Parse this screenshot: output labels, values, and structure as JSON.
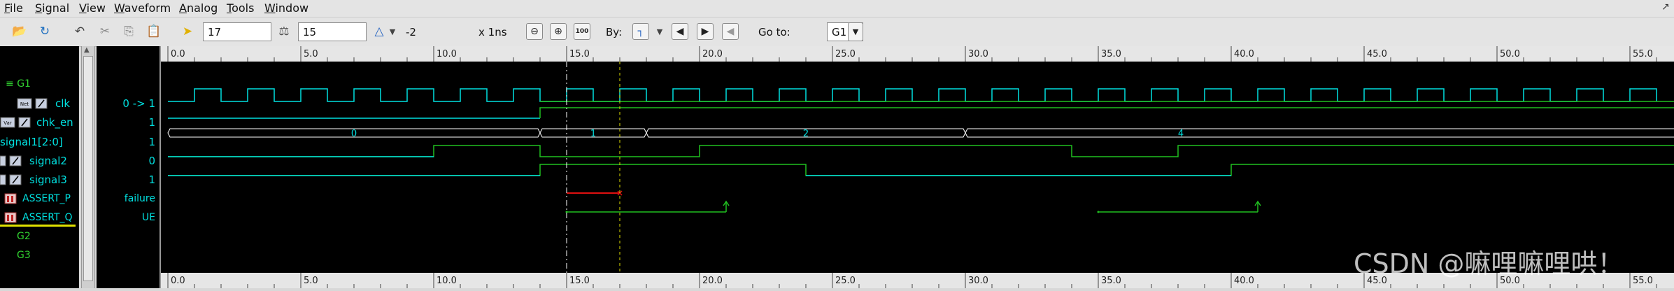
{
  "menu": [
    "File",
    "Signal",
    "View",
    "Waveform",
    "Analog",
    "Tools",
    "Window"
  ],
  "toolbar": {
    "time_value": "17",
    "step_value": "15",
    "delta_value": "-2",
    "time_unit": "x 1ns",
    "by_label": "By:",
    "goto_label": "Go to:",
    "goto_value": "G1",
    "zoom_full_label": "100"
  },
  "ruler": {
    "labels": [
      "0.0",
      "5.0",
      "10.0",
      "15.0",
      "20.0",
      "25.0",
      "30.0",
      "35.0",
      "40.0",
      "45.0",
      "50.0",
      "55.0"
    ]
  },
  "signals": [
    {
      "name": "G1",
      "value": "",
      "kind": "group"
    },
    {
      "name": "clk",
      "value": "0 -> 1",
      "kind": "signal"
    },
    {
      "name": "chk_en",
      "value": "1",
      "kind": "signal"
    },
    {
      "name": "signal1[2:0]",
      "value": "1",
      "kind": "bus"
    },
    {
      "name": "signal2",
      "value": "0",
      "kind": "signal"
    },
    {
      "name": "signal3",
      "value": "1",
      "kind": "signal"
    },
    {
      "name": "ASSERT_P",
      "value": "failure",
      "kind": "assert"
    },
    {
      "name": "ASSERT_Q",
      "value": "UE",
      "kind": "assert"
    },
    {
      "name": "G2",
      "value": "",
      "kind": "group"
    },
    {
      "name": "G3",
      "value": "",
      "kind": "group"
    }
  ],
  "bus_segments": [
    "0",
    "1",
    "2",
    "4"
  ],
  "cursors": {
    "primary_ns": 15,
    "secondary_ns": 17
  },
  "colors": {
    "signal": "#00e0e0",
    "wave_green": "#20c020",
    "assert_fail": "#e01010",
    "cursor_white": "#ffffff",
    "cursor_yellow": "#e0e000"
  },
  "watermark": "CSDN @嘛哩嘛哩哄！"
}
